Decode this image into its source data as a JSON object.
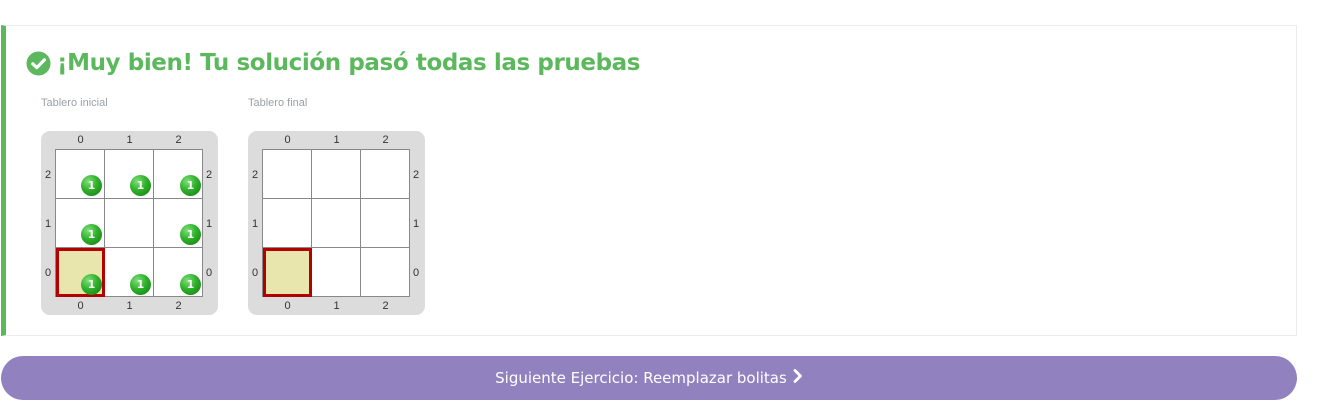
{
  "result": {
    "title": "¡Muy bien! Tu solución pasó todas las pruebas",
    "icon": "check-circle-icon",
    "accent_color": "#5cb85c"
  },
  "boards": [
    {
      "caption": "Tablero inicial",
      "columns": [
        "0",
        "1",
        "2"
      ],
      "rows": [
        "2",
        "1",
        "0"
      ],
      "head": {
        "col": 0,
        "row": 0
      },
      "cells": [
        {
          "col": 0,
          "row": 2,
          "green": "1"
        },
        {
          "col": 1,
          "row": 2,
          "green": "1"
        },
        {
          "col": 2,
          "row": 2,
          "green": "1"
        },
        {
          "col": 0,
          "row": 1,
          "green": "1"
        },
        {
          "col": 1,
          "row": 1,
          "green": null
        },
        {
          "col": 2,
          "row": 1,
          "green": "1"
        },
        {
          "col": 0,
          "row": 0,
          "green": "1"
        },
        {
          "col": 1,
          "row": 0,
          "green": "1"
        },
        {
          "col": 2,
          "row": 0,
          "green": "1"
        }
      ]
    },
    {
      "caption": "Tablero final",
      "columns": [
        "0",
        "1",
        "2"
      ],
      "rows": [
        "2",
        "1",
        "0"
      ],
      "head": {
        "col": 0,
        "row": 0
      },
      "cells": [
        {
          "col": 0,
          "row": 2,
          "green": null
        },
        {
          "col": 1,
          "row": 2,
          "green": null
        },
        {
          "col": 2,
          "row": 2,
          "green": null
        },
        {
          "col": 0,
          "row": 1,
          "green": null
        },
        {
          "col": 1,
          "row": 1,
          "green": null
        },
        {
          "col": 2,
          "row": 1,
          "green": null
        },
        {
          "col": 0,
          "row": 0,
          "green": null
        },
        {
          "col": 1,
          "row": 0,
          "green": null
        },
        {
          "col": 2,
          "row": 0,
          "green": null
        }
      ]
    }
  ],
  "next": {
    "label": "Siguiente Ejercicio: Reemplazar bolitas",
    "icon": "chevron-right-icon",
    "color": "#9182bf"
  }
}
